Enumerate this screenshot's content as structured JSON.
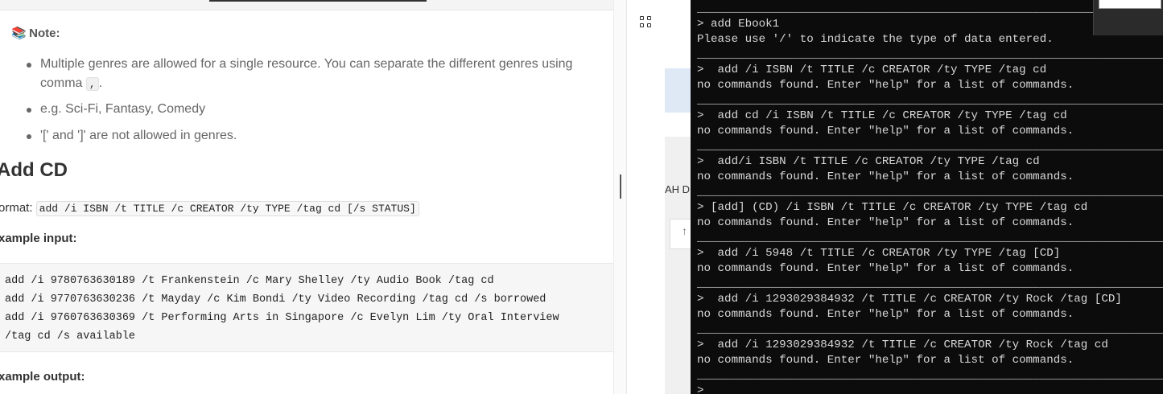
{
  "doc": {
    "note_title": "Note:",
    "bullets": [
      {
        "pre": "Multiple genres are allowed for a single resource. You can separate the different genres using comma ",
        "code": ",",
        "post": "."
      },
      {
        "text": "e.g. Sci-Fi, Fantasy, Comedy"
      },
      {
        "text": "'[' and ']' are not allowed in genres."
      }
    ],
    "heading": "Add CD",
    "format_label": "ormat:",
    "format_code": "add /i ISBN /t TITLE /c CREATOR /ty TYPE /tag cd [/s STATUS]",
    "example_input_label": "xample input:",
    "example_code": "add /i 9780763630189 /t Frankenstein /c Mary Shelley /ty Audio Book /tag cd\nadd /i 9770763630236 /t Mayday /c Kim Bondi /ty Video Recording /tag cd /s borrowed\nadd /i 9760763630369 /t Performing Arts in Singapore /c Evelyn Lim /ty Oral Interview\n/tag cd /s available",
    "example_output_label": "xample output:"
  },
  "background_window": {
    "partial_text": "AH D"
  },
  "terminal": {
    "text": "______________________________________________________________________________\n> add Ebook1\nPlease use '/' to indicate the type of data entered.\n______________________________________________________________________________\n>  add /i ISBN /t TITLE /c CREATOR /ty TYPE /tag cd\nno commands found. Enter \"help\" for a list of commands.\n______________________________________________________________________________\n>  add cd /i ISBN /t TITLE /c CREATOR /ty TYPE /tag cd\nno commands found. Enter \"help\" for a list of commands.\n______________________________________________________________________________\n>  add/i ISBN /t TITLE /c CREATOR /ty TYPE /tag cd\nno commands found. Enter \"help\" for a list of commands.\n______________________________________________________________________________\n> [add] (CD) /i ISBN /t TITLE /c CREATOR /ty TYPE /tag cd\nno commands found. Enter \"help\" for a list of commands.\n______________________________________________________________________________\n>  add /i 5948 /t TITLE /c CREATOR /ty TYPE /tag [CD]\nno commands found. Enter \"help\" for a list of commands.\n______________________________________________________________________________\n>  add /i 1293029384932 /t TITLE /c CREATOR /ty Rock /tag [CD]\nno commands found. Enter \"help\" for a list of commands.\n______________________________________________________________________________\n>  add /i 1293029384932 /t TITLE /c CREATOR /ty Rock /tag cd\nno commands found. Enter \"help\" for a list of commands.\n______________________________________________________________________________\n>"
  }
}
